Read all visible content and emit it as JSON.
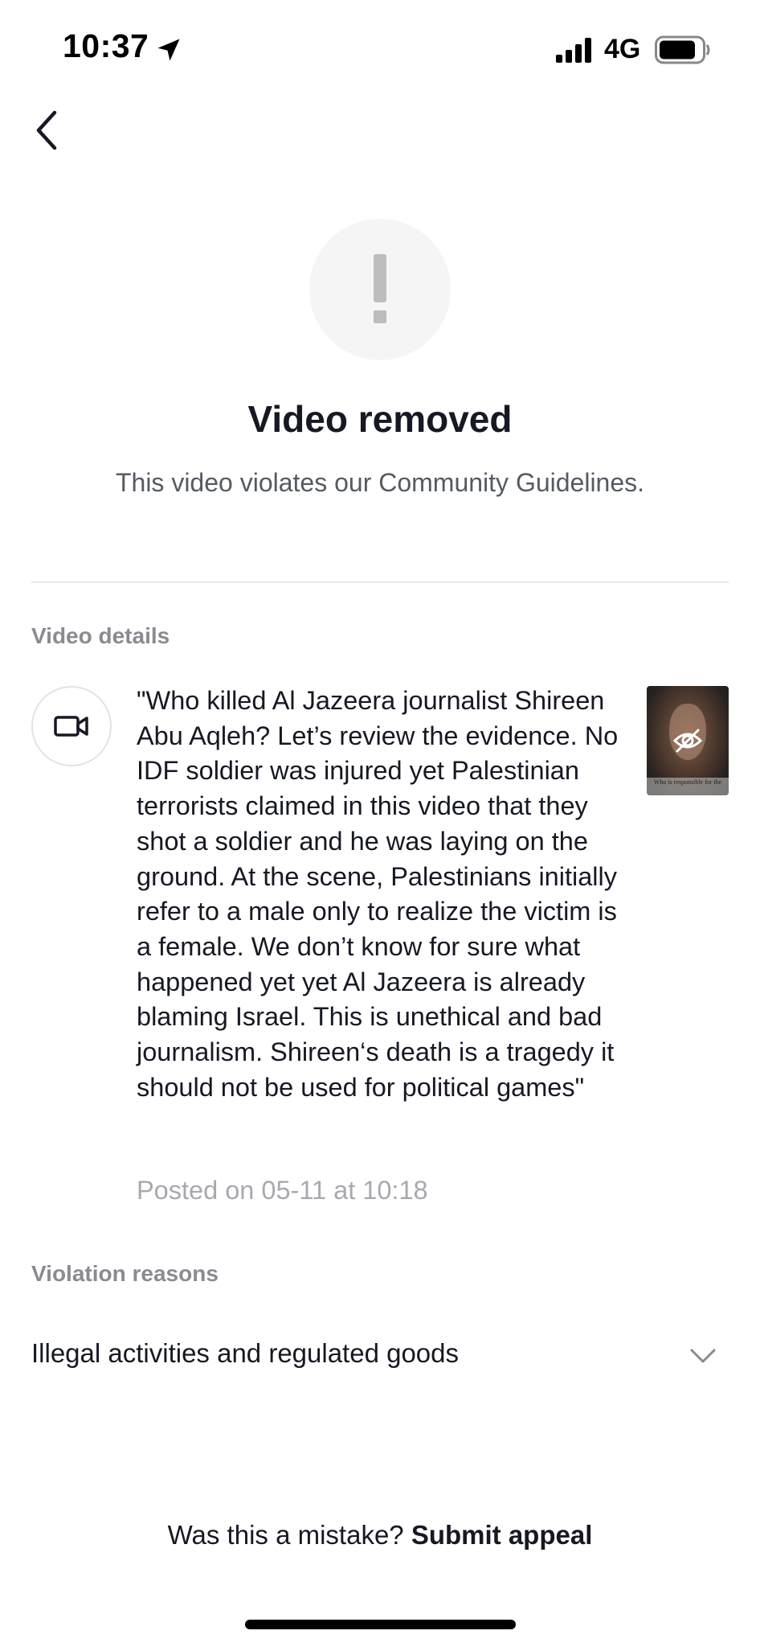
{
  "status_bar": {
    "time": "10:37",
    "network": "4G",
    "icons": [
      "location-arrow-icon",
      "signal-bars-icon",
      "battery-icon"
    ]
  },
  "header": {
    "back_icon": "chevron-left-icon"
  },
  "hero": {
    "icon": "exclamation-icon",
    "title": "Video removed",
    "subtitle": "This video violates our Community Guidelines."
  },
  "video_details": {
    "section_label": "Video details",
    "icon": "video-camera-icon",
    "caption": "\"Who killed Al Jazeera journalist Shireen Abu Aqleh? Let’s review the evidence. No IDF soldier was injured yet Palestinian terrorists claimed in this video that they shot a soldier and he was laying on the ground. At the scene, Palestinians initially refer to a male only to realize the victim is a female. We don’t know for sure what happened yet yet Al Jazeera is already blaming Israel. This is unethical and bad journalism. Shireen‘s death is a tragedy it should not be used for political games\"",
    "posted": "Posted on 05-11 at 10:18",
    "thumbnail": {
      "overlay_icon": "eye-off-icon",
      "caption_text": "Who is responsible for the"
    }
  },
  "violation": {
    "section_label": "Violation reasons",
    "reason": "Illegal activities and regulated goods",
    "expand_icon": "chevron-down-icon"
  },
  "footer": {
    "prompt": "Was this a mistake?",
    "link": "Submit appeal"
  },
  "colors": {
    "primary_text": "#161823",
    "secondary_text": "#8a8b91",
    "muted_text": "#a8a9ae",
    "icon_bg": "#f5f5f5",
    "icon_fg": "#bdbdbd",
    "divider": "#e6e6e8"
  }
}
